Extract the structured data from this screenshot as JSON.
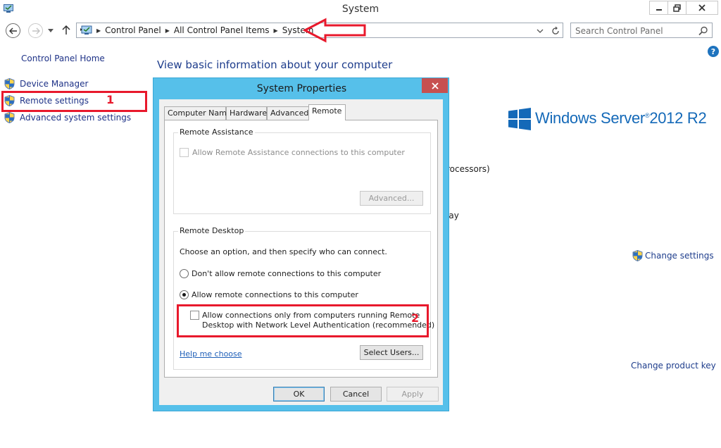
{
  "window": {
    "title": "System",
    "app_icon": "system-window-icon",
    "controls": [
      "minimize-icon",
      "maximize-icon",
      "close-icon"
    ]
  },
  "nav": {
    "breadcrumbs": [
      "Control Panel",
      "All Control Panel Items",
      "System"
    ],
    "search_placeholder": "Search Control Panel"
  },
  "sidebar": {
    "home": "Control Panel Home",
    "links": [
      {
        "label": "Device Manager",
        "icon": "shield-icon"
      },
      {
        "label": "Remote settings",
        "icon": "shield-icon"
      },
      {
        "label": "Advanced system settings",
        "icon": "shield-icon"
      }
    ]
  },
  "annotations": {
    "marker1": "1",
    "marker2": "2",
    "color": "#e8192c"
  },
  "main": {
    "heading": "View basic information about your computer",
    "edition_logo_text": "Windows Server",
    "edition_year": "2012 R2",
    "fragment_processors": "rocessors)",
    "fragment_display": "lay",
    "change_settings": "Change settings",
    "change_product_key": "Change product key",
    "help": "?"
  },
  "dialog": {
    "title": "System Properties",
    "tabs": [
      "Computer Name",
      "Hardware",
      "Advanced",
      "Remote"
    ],
    "active_tab": "Remote",
    "remote_assistance": {
      "legend": "Remote Assistance",
      "checkbox_label": "Allow Remote Assistance connections to this computer",
      "advanced_button": "Advanced..."
    },
    "remote_desktop": {
      "legend": "Remote Desktop",
      "instruction": "Choose an option, and then specify who can connect.",
      "option_dont_allow": "Don't allow remote connections to this computer",
      "option_allow": "Allow remote connections to this computer",
      "nla_line1": "Allow connections only from computers running Remote",
      "nla_line2": "Desktop with Network Level Authentication (recommended)",
      "help_link": "Help me choose",
      "select_users": "Select Users..."
    },
    "buttons": {
      "ok": "OK",
      "cancel": "Cancel",
      "apply": "Apply"
    }
  },
  "colors": {
    "link": "#1e3287",
    "dialog_frame": "#56c0ea",
    "close_button": "#c75050",
    "brand_blue": "#1469b8"
  }
}
